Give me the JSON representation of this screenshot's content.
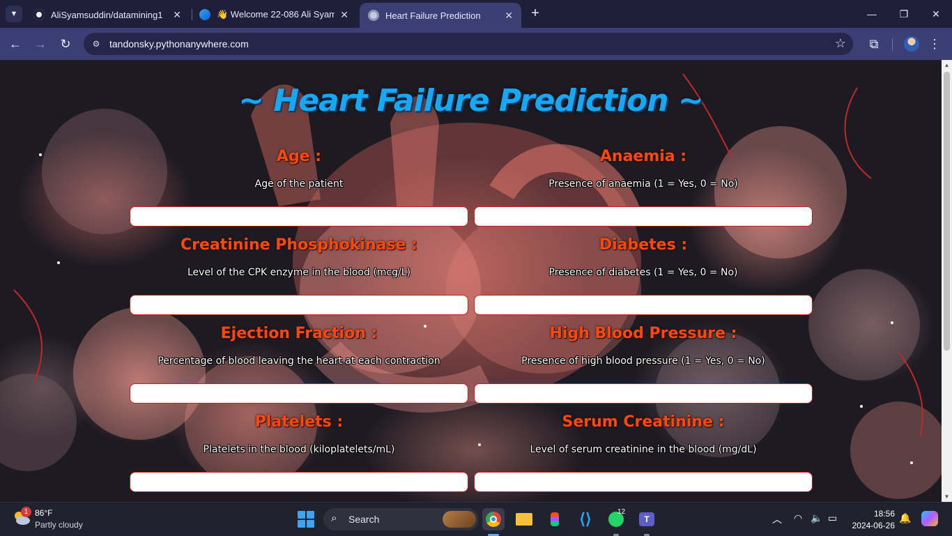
{
  "browser": {
    "tabs": [
      {
        "title": "AliSyamsuddin/datamining1",
        "favicon": "github-icon",
        "active": false
      },
      {
        "title": "👋 Welcome 22-086 Ali Syamsu",
        "favicon": "edge-icon",
        "active": false
      },
      {
        "title": "Heart Failure Prediction",
        "favicon": "globe-icon",
        "active": true
      }
    ],
    "url": "tandonsky.pythonanywhere.com",
    "window_controls": {
      "minimize": "—",
      "restore": "❐",
      "close": "✕"
    }
  },
  "page": {
    "title": "~ Heart Failure Prediction ~",
    "fields": [
      {
        "label": "Age :",
        "description": "Age of the patient",
        "value": ""
      },
      {
        "label": "Anaemia :",
        "description": "Presence of anaemia (1 = Yes, 0 = No)",
        "value": ""
      },
      {
        "label": "Creatinine Phosphokinase :",
        "description": "Level of the CPK enzyme in the blood (mcg/L)",
        "value": ""
      },
      {
        "label": "Diabetes :",
        "description": "Presence of diabetes (1 = Yes, 0 = No)",
        "value": ""
      },
      {
        "label": "Ejection Fraction :",
        "description": "Percentage of blood leaving the heart at each contraction",
        "value": ""
      },
      {
        "label": "High Blood Pressure :",
        "description": "Presence of high blood pressure (1 = Yes, 0 = No)",
        "value": ""
      },
      {
        "label": "Platelets :",
        "description": "Platelets in the blood (kiloplatelets/mL)",
        "value": ""
      },
      {
        "label": "Serum Creatinine :",
        "description": "Level of serum creatinine in the blood (mg/dL)",
        "value": ""
      }
    ],
    "colors": {
      "title": "#18a7f2",
      "label": "#f24a10",
      "input_border": "#d11c1c"
    }
  },
  "taskbar": {
    "weather": {
      "temp": "86°F",
      "condition": "Partly cloudy",
      "badge": "1"
    },
    "search_label": "Search",
    "whatsapp_badge": "12",
    "time": "18:56",
    "date": "2024-06-26"
  }
}
